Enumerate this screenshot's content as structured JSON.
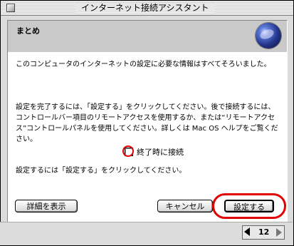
{
  "window": {
    "title": "インターネット接続アシスタント"
  },
  "header": {
    "title": "まとめ"
  },
  "body": {
    "intro": "このコンピュータのインターネットの設定に必要な情報はすべてそろいました。",
    "instructions": "設定を完了するには、「設定する」をクリックしてください。後で接続するには、コントロールバー項目のリモートアクセスを使用するか、または“リモートアクセス”コントロールパネルを使用してください。詳しくは Mac OS ヘルプをご覧ください。",
    "checkbox_label": "終了時に接続",
    "checkbox_checked": false,
    "prompt": "設定するには「設定する」をクリックしてください。"
  },
  "buttons": {
    "details": "詳細を表示",
    "cancel": "キャンセル",
    "set": "設定する"
  },
  "pager": {
    "page": "12"
  },
  "colors": {
    "highlight": "#e20000"
  },
  "icons": {
    "header": "globe-icon"
  }
}
